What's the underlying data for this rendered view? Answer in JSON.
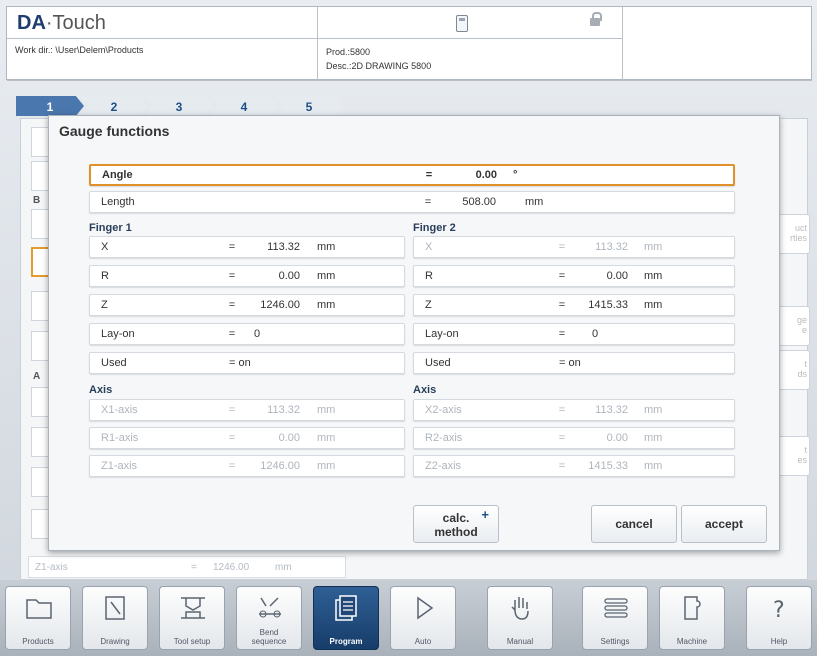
{
  "header": {
    "logo_brand": "DA",
    "logo_product": "·Touch",
    "workdir": "Work dir.: \\User\\Delem\\Products",
    "prod": "Prod.:5800",
    "desc": "Desc.:2D DRAWING 5800"
  },
  "tabs": [
    "1",
    "2",
    "3",
    "4",
    "5"
  ],
  "background": {
    "label_b": "B",
    "label_a": "A",
    "z1_label": "Z1-axis",
    "z1_eq": "=",
    "z1_value": "1246.00",
    "z1_unit": "mm",
    "side_buttons": [
      "uct\nrties",
      "ge\ne",
      "t\nds",
      "t\nes"
    ]
  },
  "dialog": {
    "title": "Gauge functions",
    "angle": {
      "label": "Angle",
      "eq": "=",
      "value": "0.00",
      "unit": "°"
    },
    "length": {
      "label": "Length",
      "eq": "=",
      "value": "508.00",
      "unit": "mm"
    },
    "finger1": {
      "title": "Finger 1",
      "rows": [
        {
          "label": "X",
          "eq": "=",
          "value": "113.32",
          "unit": "mm"
        },
        {
          "label": "R",
          "eq": "=",
          "value": "0.00",
          "unit": "mm"
        },
        {
          "label": "Z",
          "eq": "=",
          "value": "1246.00",
          "unit": "mm"
        },
        {
          "label": "Lay-on",
          "eq": "=",
          "value": "0",
          "unit": ""
        },
        {
          "label": "Used",
          "eq": "= on",
          "value": "",
          "unit": ""
        }
      ]
    },
    "finger2": {
      "title": "Finger 2",
      "rows": [
        {
          "label": "X",
          "eq": "=",
          "value": "113.32",
          "unit": "mm"
        },
        {
          "label": "R",
          "eq": "=",
          "value": "0.00",
          "unit": "mm"
        },
        {
          "label": "Z",
          "eq": "=",
          "value": "1415.33",
          "unit": "mm"
        },
        {
          "label": "Lay-on",
          "eq": "=",
          "value": "0",
          "unit": ""
        },
        {
          "label": "Used",
          "eq": "= on",
          "value": "",
          "unit": ""
        }
      ]
    },
    "axis1": {
      "title": "Axis",
      "rows": [
        {
          "label": "X1-axis",
          "eq": "=",
          "value": "113.32",
          "unit": "mm"
        },
        {
          "label": "R1-axis",
          "eq": "=",
          "value": "0.00",
          "unit": "mm"
        },
        {
          "label": "Z1-axis",
          "eq": "=",
          "value": "1246.00",
          "unit": "mm"
        }
      ]
    },
    "axis2": {
      "title": "Axis",
      "rows": [
        {
          "label": "X2-axis",
          "eq": "=",
          "value": "113.32",
          "unit": "mm"
        },
        {
          "label": "R2-axis",
          "eq": "=",
          "value": "0.00",
          "unit": "mm"
        },
        {
          "label": "Z2-axis",
          "eq": "=",
          "value": "1415.33",
          "unit": "mm"
        }
      ]
    },
    "calc_line1": "calc.",
    "calc_line2": "method",
    "calc_plus": "+",
    "cancel": "cancel",
    "accept": "accept"
  },
  "toolbar": [
    {
      "label": "Products",
      "icon": "folder-icon"
    },
    {
      "label": "Drawing",
      "icon": "drawing-icon"
    },
    {
      "label": "Tool setup",
      "icon": "tool-setup-icon"
    },
    {
      "label": "Bend\nsequence",
      "icon": "bend-sequence-icon"
    },
    {
      "label": "Program",
      "icon": "program-icon"
    },
    {
      "label": "Auto",
      "icon": "play-icon"
    },
    {
      "label": "Manual",
      "icon": "hand-icon"
    },
    {
      "label": "Settings",
      "icon": "settings-icon"
    },
    {
      "label": "Machine",
      "icon": "machine-icon"
    },
    {
      "label": "Help",
      "icon": "help-icon"
    }
  ],
  "colors": {
    "accent": "#1d4f87",
    "highlight": "#e0902a",
    "active_button": "#1f4676"
  }
}
